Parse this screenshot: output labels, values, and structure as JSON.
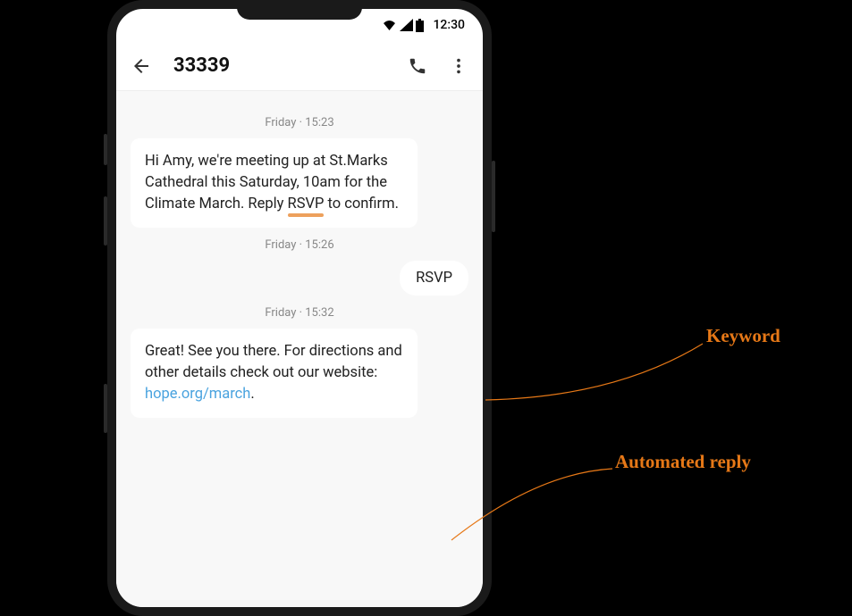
{
  "status": {
    "time": "12:30"
  },
  "header": {
    "contact": "33339"
  },
  "messages": {
    "ts1": "Friday · 15:23",
    "msg1_pre": "Hi Amy, we're meeting up at St.Marks Cathedral this Saturday, 10am for the Climate March. Reply ",
    "msg1_keyword": "RSVP",
    "msg1_post": " to confirm.",
    "ts2": "Friday · 15:26",
    "msg2": "RSVP",
    "ts3": "Friday · 15:32",
    "msg3_pre": "Great! See you there. For directions and other details check out our website: ",
    "msg3_link": "hope.org/march",
    "msg3_post": "."
  },
  "annotations": {
    "keyword": "Keyword",
    "reply": "Automated reply"
  }
}
